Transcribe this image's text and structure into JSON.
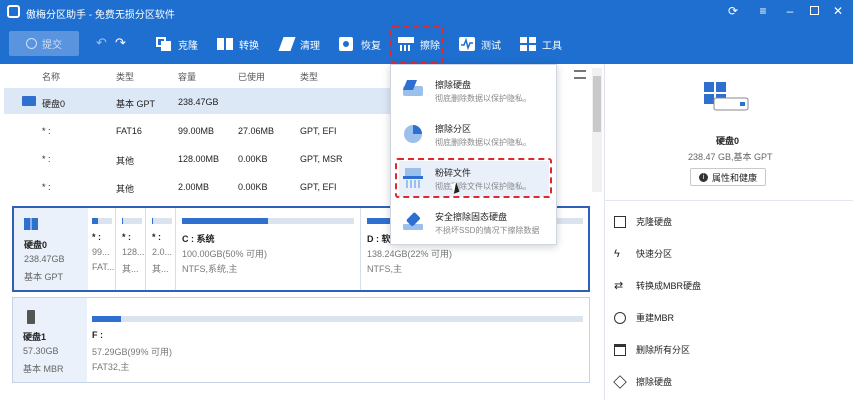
{
  "app": {
    "title": "傲梅分区助手 - 免费无损分区软件"
  },
  "toolbar": {
    "commit": "提交",
    "clone": "克隆",
    "convert": "转换",
    "clean": "清理",
    "restore": "恢复",
    "wipe": "擦除",
    "test": "测试",
    "tools": "工具"
  },
  "table": {
    "headers": [
      "名称",
      "类型",
      "容量",
      "已使用",
      "类型"
    ],
    "rows": [
      [
        "硬盘0",
        "基本 GPT",
        "238.47GB",
        "",
        ""
      ],
      [
        "* :",
        "FAT16",
        "99.00MB",
        "27.06MB",
        "GPT, EFI"
      ],
      [
        "* :",
        "其他",
        "128.00MB",
        "0.00KB",
        "GPT, MSR"
      ],
      [
        "* :",
        "其他",
        "2.00MB",
        "0.00KB",
        "GPT, EFI"
      ]
    ]
  },
  "wipe_menu": {
    "items": [
      {
        "title": "擦除硬盘",
        "desc": "彻底删除数据以保护隐私。"
      },
      {
        "title": "擦除分区",
        "desc": "彻底删除数据以保护隐私。"
      },
      {
        "title": "粉碎文件",
        "desc": "彻底删除文件以保护隐私。"
      },
      {
        "title": "安全擦除固态硬盘",
        "desc": "不损坏SSD的情况下擦除数据"
      }
    ]
  },
  "disks": [
    {
      "name": "硬盘0",
      "size": "238.47GB",
      "type": "基本 GPT",
      "parts": [
        {
          "label": "* :",
          "l2": "99...",
          "l3": "FAT..."
        },
        {
          "label": "* :",
          "l2": "128...",
          "l3": "其..."
        },
        {
          "label": "* :",
          "l2": "2.0...",
          "l3": "其..."
        },
        {
          "label": "C : 系统",
          "l2": "100.00GB(50% 可用)",
          "l3": "NTFS,系统,主"
        },
        {
          "label": "D : 软...",
          "l2": "138.24GB(22% 可用)",
          "l3": "NTFS,主"
        }
      ],
      "part_used": [
        0.3,
        0.0,
        0.0,
        0.5,
        0.78
      ]
    },
    {
      "name": "硬盘1",
      "size": "57.30GB",
      "type": "基本 MBR",
      "parts": [
        {
          "label": "F :",
          "l2": "57.29GB(99% 可用)",
          "l3": "FAT32,主"
        }
      ],
      "part_used": [
        0.01
      ]
    }
  ],
  "right_panel": {
    "disk_name": "硬盘0",
    "disk_info": "238.47 GB,基本 GPT",
    "properties": "属性和健康",
    "actions": [
      "克隆硬盘",
      "快速分区",
      "转换成MBR硬盘",
      "重建MBR",
      "删除所有分区",
      "擦除硬盘"
    ]
  },
  "colors": {
    "accent": "#1e6fcf",
    "highlight": "#e0282f",
    "bar": "#2f6fd0"
  }
}
